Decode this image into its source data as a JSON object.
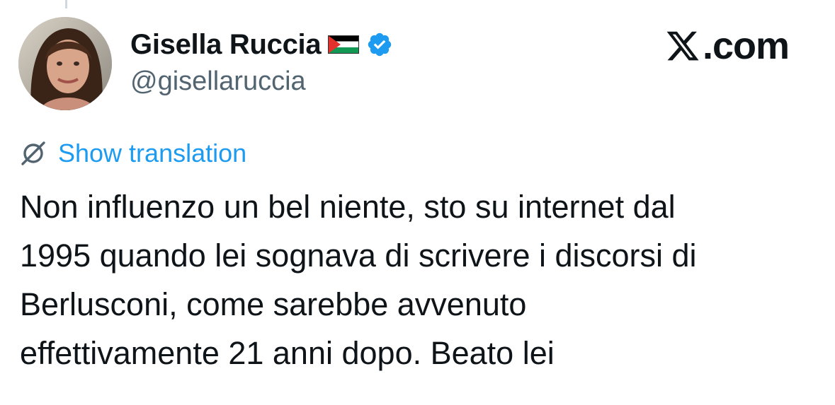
{
  "author": {
    "display_name": "Gisella Ruccia",
    "handle": "@gisellaruccia",
    "flag_icon": "palestine-flag-icon",
    "verified_icon": "verified-badge-icon",
    "verified_color": "#1d9bf0"
  },
  "brand": {
    "label": ".com",
    "logo_icon": "x-logo-icon"
  },
  "translation": {
    "icon": "globe-translate-icon",
    "link_label": "Show translation",
    "link_color": "#1d9bf0"
  },
  "tweet": {
    "lines": [
      "Non influenzo un bel niente, sto su internet dal",
      "1995 quando lei sognava di scrivere i discorsi di",
      "Berlusconi, come sarebbe avvenuto",
      "effettivamente 21 anni dopo. Beato lei"
    ]
  }
}
